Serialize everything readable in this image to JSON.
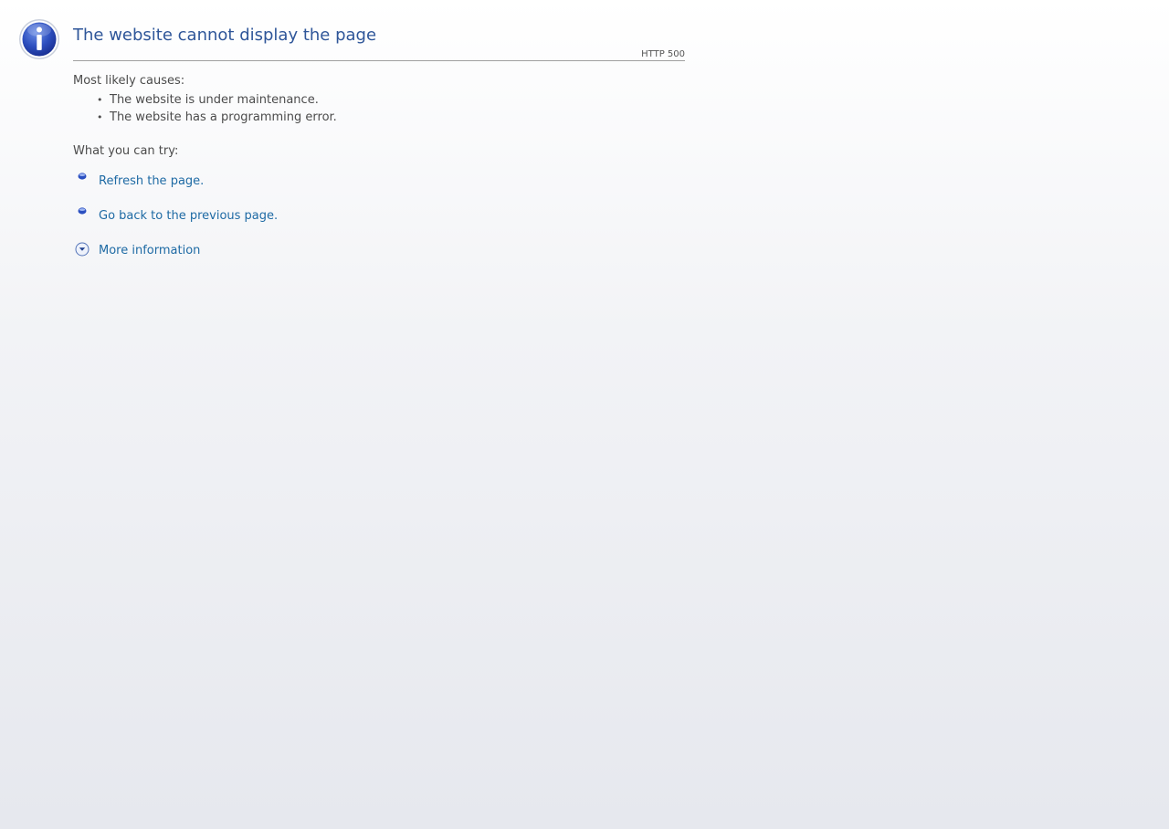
{
  "title": "The website cannot display the page",
  "http_code": "HTTP 500",
  "causes": {
    "label": "Most likely causes:",
    "items": [
      "The website is under maintenance.",
      "The website has a programming error."
    ]
  },
  "try": {
    "label": "What you can try:",
    "refresh_label": "Refresh the page.",
    "back_label": "Go back to the previous page.",
    "more_info_label": "More information"
  },
  "icons": {
    "header": "info-icon",
    "action_bullet": "blue-bullet-icon",
    "expand": "chevron-down-circle-icon"
  },
  "colors": {
    "title": "#2f5699",
    "link": "#1e6aa4",
    "text": "#4b4b4b"
  }
}
